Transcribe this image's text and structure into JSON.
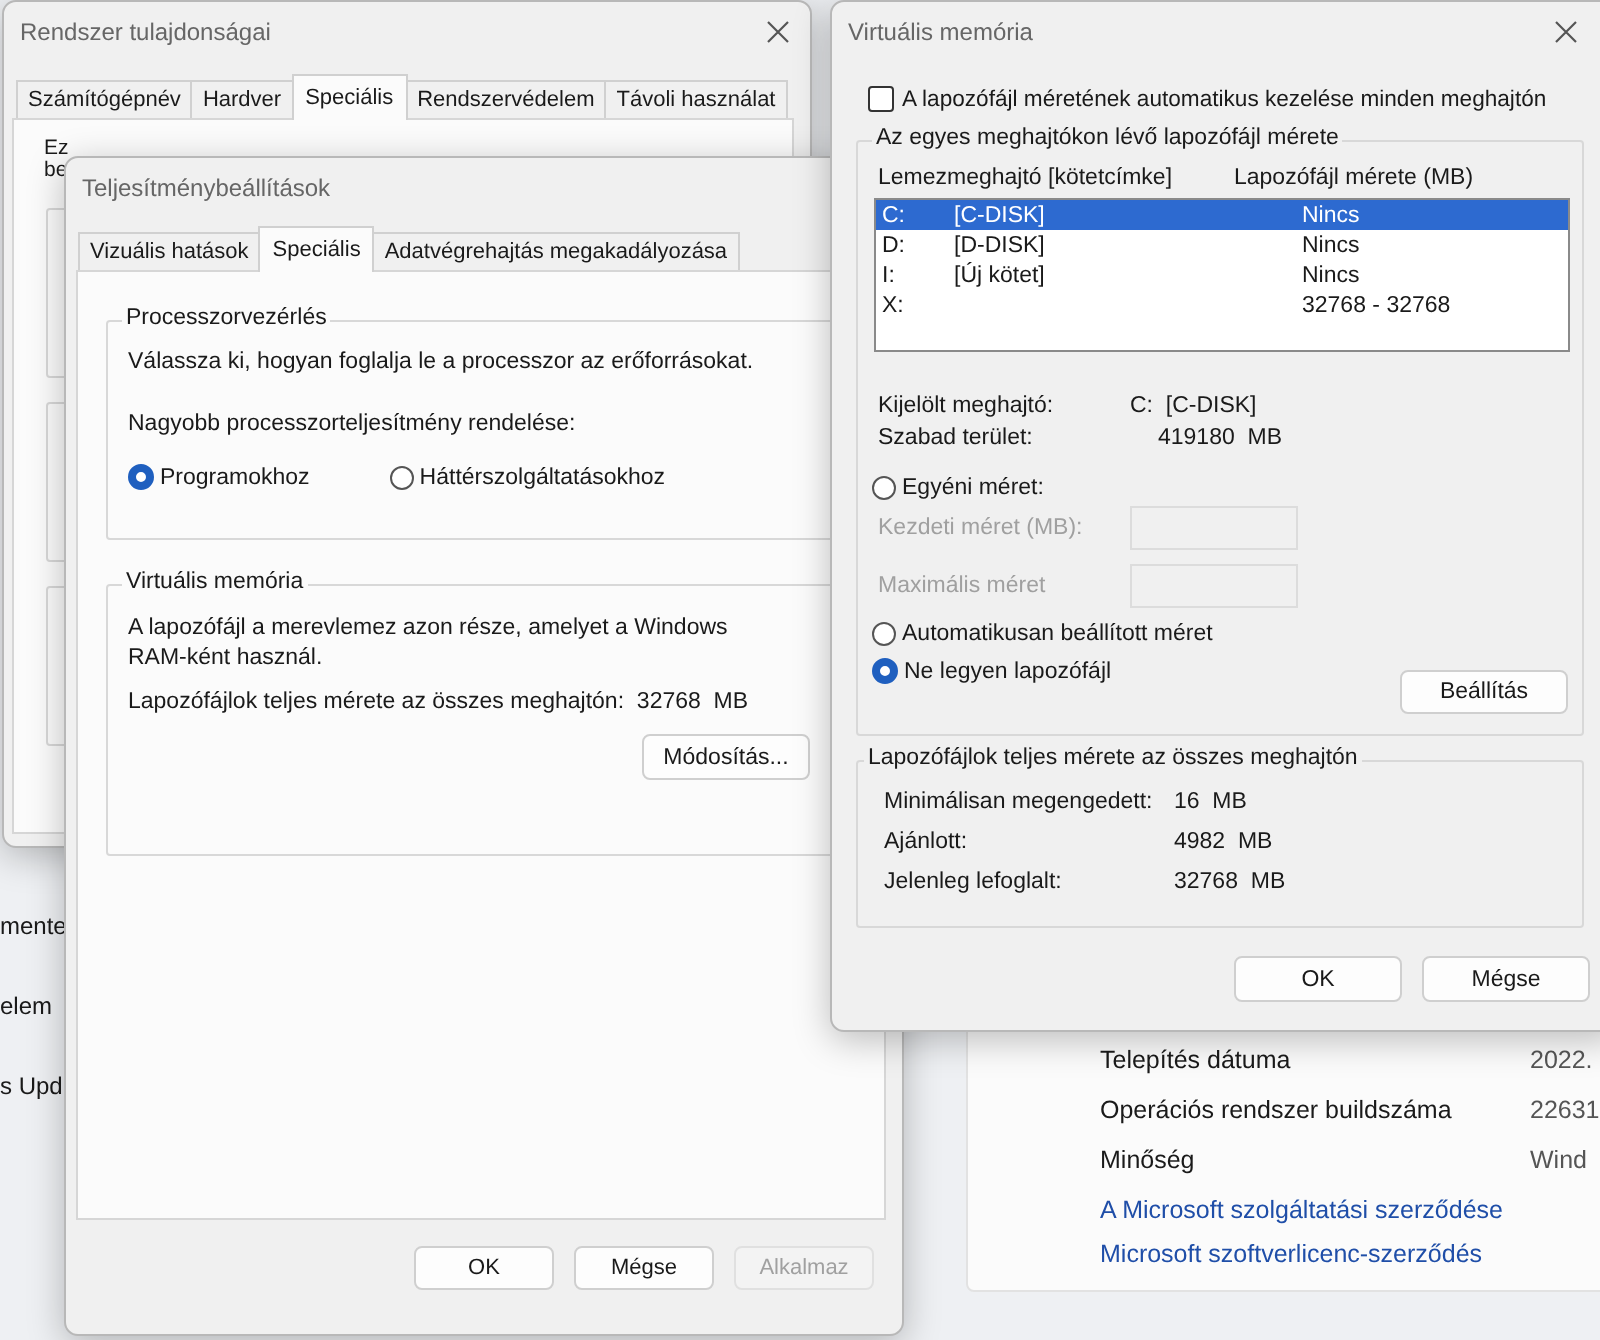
{
  "background": {
    "side_items": [
      "mente",
      "elem",
      "s Upd"
    ],
    "info_rows": [
      {
        "label": "Telepítés dátuma",
        "value": "2022."
      },
      {
        "label": "Operációs rendszer buildszáma",
        "value": "22631"
      },
      {
        "label": "Minőség",
        "value": "Wind"
      }
    ],
    "links": [
      "A Microsoft szolgáltatási szerződése",
      "Microsoft szoftverlicenc-szerződés"
    ]
  },
  "system_properties": {
    "title": "Rendszer tulajdonságai",
    "tabs": [
      {
        "label": "Számítógépnév",
        "selected": false
      },
      {
        "label": "Hardver",
        "selected": false
      },
      {
        "label": "Speciális",
        "selected": true
      },
      {
        "label": "Rendszervédelem",
        "selected": false
      },
      {
        "label": "Távoli használat",
        "selected": false
      }
    ],
    "text_fragments": [
      "Ez",
      "be"
    ]
  },
  "performance_options": {
    "title": "Teljesítménybeállítások",
    "tabs": [
      {
        "label": "Vizuális hatások",
        "selected": false
      },
      {
        "label": "Speciális",
        "selected": true
      },
      {
        "label": "Adatvégrehajtás megakadályozása",
        "selected": false
      }
    ],
    "processor_group": {
      "title": "Processzorvezérlés",
      "description": "Válassza ki, hogyan foglalja le a processzor az erőforrásokat.",
      "prompt": "Nagyobb processzorteljesítmény rendelése:",
      "options": [
        {
          "label": "Programokhoz",
          "selected": true
        },
        {
          "label": "Háttérszolgáltatásokhoz",
          "selected": false
        }
      ]
    },
    "virtual_memory_group": {
      "title": "Virtuális memória",
      "description": "A lapozófájl a merevlemez azon része, amelyet a Windows RAM-ként használ.",
      "total_label": "Lapozófájlok teljes mérete az összes meghajtón:",
      "total_value": "32768  MB",
      "button": "Módosítás..."
    },
    "buttons": [
      {
        "label": "OK",
        "disabled": false
      },
      {
        "label": "Mégse",
        "disabled": false
      },
      {
        "label": "Alkalmaz",
        "disabled": true
      }
    ]
  },
  "virtual_memory": {
    "title": "Virtuális memória",
    "auto_manage": {
      "label": "A lapozófájl méretének automatikus kezelése minden meghajtón",
      "checked": false
    },
    "drives_group": {
      "title": "Az egyes meghajtókon lévő lapozófájl mérete",
      "columns": [
        "Lemezmeghajtó [kötetcímke]",
        "Lapozófájl mérete (MB)"
      ],
      "rows": [
        {
          "drive": "C:",
          "label": "[C-DISK]",
          "size": "Nincs",
          "selected": true
        },
        {
          "drive": "D:",
          "label": "[D-DISK]",
          "size": "Nincs",
          "selected": false
        },
        {
          "drive": "I:",
          "label": "[Új kötet]",
          "size": "Nincs",
          "selected": false
        },
        {
          "drive": "X:",
          "size": "32768 - 32768",
          "selected": false
        }
      ]
    },
    "selected_drive": {
      "label": "Kijelölt meghajtó:",
      "value": "C:  [C-DISK]"
    },
    "free_space": {
      "label": "Szabad terület:",
      "value": "419180  MB"
    },
    "custom_size": {
      "label": "Egyéni méret:",
      "selected": false
    },
    "size_fields": [
      {
        "label": "Kezdeti méret (MB):",
        "disabled": true
      },
      {
        "label": "Maximális méret",
        "disabled": true
      }
    ],
    "other_options": [
      {
        "label": "Automatikusan beállított méret",
        "selected": false
      },
      {
        "label": "Ne legyen lapozófájl",
        "selected": true
      }
    ],
    "set_button": "Beállítás",
    "totals_group": {
      "title": "Lapozófájlok teljes mérete az összes meghajtón",
      "rows": [
        {
          "label": "Minimálisan megengedett:",
          "value": "16  MB"
        },
        {
          "label": "Ajánlott:",
          "value": "4982  MB"
        },
        {
          "label": "Jelenleg lefoglalt:",
          "value": "32768  MB"
        }
      ]
    },
    "buttons": [
      "OK",
      "Mégse"
    ]
  }
}
